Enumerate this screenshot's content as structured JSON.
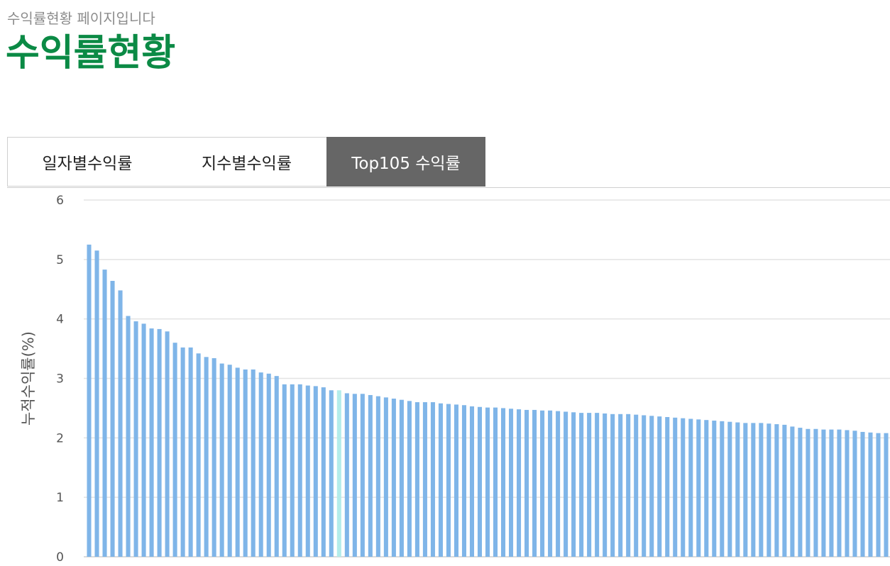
{
  "header": {
    "subtitle": "수익률현황 페이지입니다",
    "title": "수익률현황"
  },
  "tabs": [
    {
      "label": "일자별수익률",
      "active": false
    },
    {
      "label": "지수별수익률",
      "active": false
    },
    {
      "label": "Top105 수익률",
      "active": true
    }
  ],
  "colors": {
    "title": "#0b8a45",
    "bar": "#7fb5e8",
    "bar_highlight": "#b3ecea",
    "active_tab": "#666666",
    "grid": "#e3e3e3"
  },
  "chart_data": {
    "type": "bar",
    "ylabel": "누적수익률(%)",
    "ylim": [
      0,
      6
    ],
    "yticks": [
      0,
      1,
      2,
      3,
      4,
      5,
      6
    ],
    "grid": true,
    "highlight_index": 32,
    "values": [
      5.25,
      5.15,
      4.83,
      4.64,
      4.48,
      4.05,
      3.96,
      3.92,
      3.84,
      3.83,
      3.79,
      3.6,
      3.52,
      3.52,
      3.42,
      3.36,
      3.34,
      3.25,
      3.23,
      3.18,
      3.15,
      3.15,
      3.1,
      3.08,
      3.04,
      2.9,
      2.9,
      2.9,
      2.88,
      2.87,
      2.85,
      2.8,
      2.8,
      2.75,
      2.74,
      2.74,
      2.72,
      2.7,
      2.68,
      2.66,
      2.64,
      2.62,
      2.6,
      2.6,
      2.6,
      2.58,
      2.57,
      2.56,
      2.55,
      2.53,
      2.52,
      2.51,
      2.51,
      2.5,
      2.49,
      2.48,
      2.47,
      2.47,
      2.46,
      2.46,
      2.45,
      2.44,
      2.43,
      2.42,
      2.42,
      2.42,
      2.41,
      2.4,
      2.4,
      2.4,
      2.39,
      2.38,
      2.37,
      2.36,
      2.35,
      2.34,
      2.33,
      2.32,
      2.31,
      2.3,
      2.29,
      2.28,
      2.27,
      2.26,
      2.25,
      2.25,
      2.25,
      2.24,
      2.23,
      2.22,
      2.19,
      2.17,
      2.15,
      2.15,
      2.14,
      2.14,
      2.14,
      2.13,
      2.12,
      2.1,
      2.09,
      2.08,
      2.08
    ]
  }
}
